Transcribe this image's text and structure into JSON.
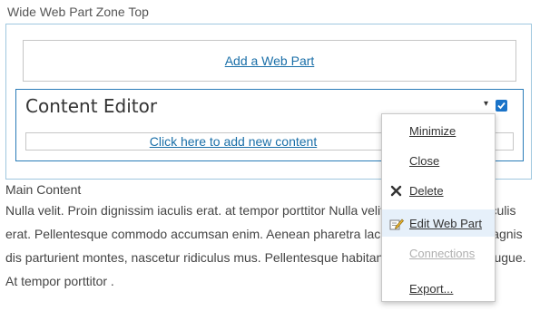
{
  "zone": {
    "title": "Wide Web Part Zone Top",
    "add_web_part": "Add a Web Part"
  },
  "webpart": {
    "title": "Content Editor",
    "add_content_link": "Click here to add new content",
    "menu_arrow_icon": "chevron-down-icon",
    "checkbox_checked": true
  },
  "main": {
    "label": "Main Content",
    "text": "Nulla velit. Proin dignissim iaculis erat. at tempor porttitor Nulla velit. Proin dignissim iaculis erat. Pellentesque commodo accumsan enim. Aenean pharetra lacinia. Penatibus et magnis dis parturient montes, nascetur ridiculus mus. Pellentesque habitant amet elit. Mauris augue.  At tempor porttitor ."
  },
  "menu": {
    "items": [
      {
        "label": "Minimize",
        "icon": "",
        "state": "normal"
      },
      {
        "label": "Close",
        "icon": "",
        "state": "normal"
      },
      {
        "label": "Delete",
        "icon": "close-x-icon",
        "state": "normal"
      },
      {
        "label": "Edit Web Part",
        "icon": "edit-pencil-icon",
        "state": "hover"
      },
      {
        "label": "Connections",
        "icon": "",
        "state": "disabled"
      },
      {
        "label": "Export...",
        "icon": "",
        "state": "normal"
      }
    ]
  },
  "colors": {
    "link": "#1a6fa8",
    "webpart_border": "#2a7cb8",
    "zone_border": "#9fc7df",
    "checkbox": "#1a73c8",
    "menu_hover": "#e6f0fa",
    "disabled_text": "#b0b0b0"
  }
}
